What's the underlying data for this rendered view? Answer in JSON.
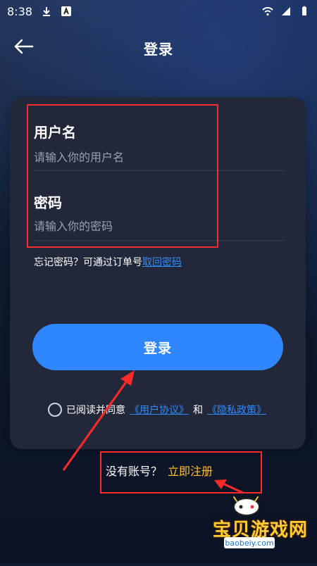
{
  "status_bar": {
    "time": "8:38",
    "icons": [
      "download-icon",
      "a-icon",
      "wifi-icon",
      "signal-icon",
      "battery-icon"
    ]
  },
  "header": {
    "title": "登录",
    "back_icon": "arrow-left-icon"
  },
  "form": {
    "username": {
      "label": "用户名",
      "placeholder": "请输入你的用户名"
    },
    "password": {
      "label": "密码",
      "placeholder": "请输入你的密码"
    },
    "forgot": {
      "text": "忘记密码？可通过订单号",
      "link": "取回密码"
    },
    "login_button": "登录",
    "agreement": {
      "prefix": "已阅读并同意",
      "user_agreement": "《用户协议》",
      "and": "和",
      "privacy_policy": "《隐私政策》"
    }
  },
  "register": {
    "prompt": "没有账号？",
    "link": "立即注册"
  },
  "watermark": {
    "name": "宝贝游戏网",
    "url": "baobeiy.com"
  },
  "colors": {
    "background": "#0f1a2f",
    "card": "#22283a",
    "primary": "#2f86ff",
    "link": "#2f8bff",
    "register": "#ffbe2e",
    "annotation": "#ff2b2b"
  }
}
